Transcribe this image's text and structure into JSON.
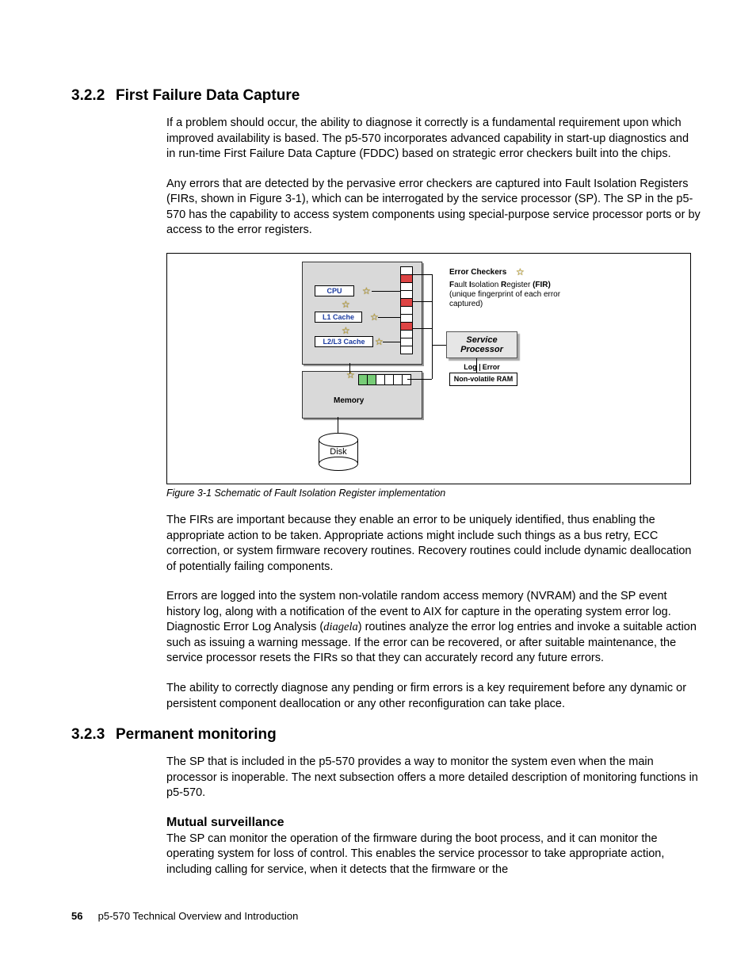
{
  "section1": {
    "num": "3.2.2",
    "title": "First Failure Data Capture",
    "p1": "If a problem should occur, the ability to diagnose it correctly is a fundamental requirement upon which improved availability is based. The p5-570 incorporates advanced capability in start-up diagnostics and in run-time First Failure Data Capture (FDDC) based on strategic error checkers built into the chips.",
    "p2": "Any errors that are detected by the pervasive error checkers are captured into Fault Isolation Registers (FIRs, shown in Figure 3-1), which can be interrogated by the service processor (SP). The SP in the p5-570 has the capability to access system components using special-purpose service processor ports or by access to the error registers.",
    "p3": "The FIRs are important because they enable an error to be uniquely identified, thus enabling the appropriate action to be taken. Appropriate actions might include such things as a bus retry, ECC correction, or system firmware recovery routines. Recovery routines could include dynamic deallocation of potentially failing components.",
    "p4a": "Errors are logged into the system non-volatile random access memory (NVRAM) and the SP event history log, along with a notification of the event to AIX for capture in the operating system error log. Diagnostic Error Log Analysis (",
    "p4b": "diagela",
    "p4c": ") routines analyze the error log entries and invoke a suitable action such as issuing a warning message. If the error can be recovered, or after suitable maintenance, the service processor resets the FIRs so that they can accurately record any future errors.",
    "p5": "The ability to correctly diagnose any pending or firm errors is a key requirement before any dynamic or persistent component deallocation or any other reconfiguration can take place."
  },
  "figure": {
    "caption": "Figure 3-1   Schematic of Fault Isolation Register implementation",
    "cpu": "CPU",
    "l1": "L1 Cache",
    "l2l3": "L2/L3 Cache",
    "memory": "Memory",
    "disk": "Disk",
    "error_checkers": "Error Checkers",
    "fir_b1": "F",
    "fir_t1": "ault ",
    "fir_b2": "I",
    "fir_t2": "solation ",
    "fir_b3": "R",
    "fir_t3": "egister ",
    "fir_b4": "(FIR)",
    "fir_sub": "(unique fingerprint of each error captured)",
    "service_processor": "Service Processor",
    "log": "Log",
    "error": "Error",
    "nvram": "Non-volatile RAM"
  },
  "section2": {
    "num": "3.2.3",
    "title": "Permanent monitoring",
    "p1": "The SP that is included in the p5-570 provides a way to monitor the system even when the main processor is inoperable. The next subsection offers a more detailed description of monitoring functions in p5-570.",
    "sub1_title": "Mutual surveillance",
    "sub1_p1": "The SP can monitor the operation of the firmware during the boot process, and it can monitor the operating system for loss of control. This enables the service processor to take appropriate action, including calling for service, when it detects that the firmware or the"
  },
  "footer": {
    "page": "56",
    "doc": "p5-570 Technical Overview and Introduction"
  }
}
